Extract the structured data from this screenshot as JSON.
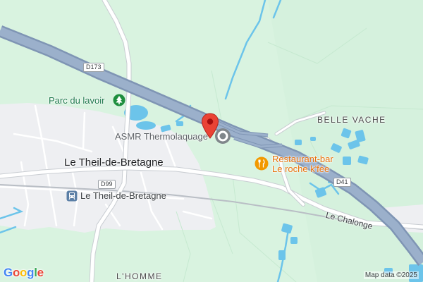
{
  "map": {
    "labels": {
      "park": "Parc du lavoir",
      "business": "ASMR Thermolaquage",
      "locality_east": "BELLE VACHE",
      "town": "Le Theil-de-Bretagne",
      "station": "Le Theil-de-Bretagne",
      "restaurant_line1": "Restaurant-bar",
      "restaurant_line2": "Le roche k'fée",
      "street": "Le Chalonge",
      "locality_south": "L'HOMME"
    },
    "roads": {
      "d173": "D173",
      "d99": "D99",
      "d41": "D41"
    },
    "attribution": "Map data ©2025",
    "logo_letters": [
      "G",
      "o",
      "o",
      "g",
      "l",
      "e"
    ],
    "logo_colors": [
      "#4285F4",
      "#EA4335",
      "#FBBC05",
      "#4285F4",
      "#34A853",
      "#EA4335"
    ],
    "colors": {
      "background": "#d9f3e0",
      "urban": "#eeeff2",
      "motorway": "#8fa3bf",
      "water": "#6cc4ea",
      "pin": "#ea4335",
      "park_icon": "#1e8e3e",
      "restaurant_icon": "#f29900"
    },
    "icons": [
      "map-pin-icon",
      "business-marker-icon",
      "park-tree-icon",
      "restaurant-icon",
      "train-station-icon"
    ]
  }
}
